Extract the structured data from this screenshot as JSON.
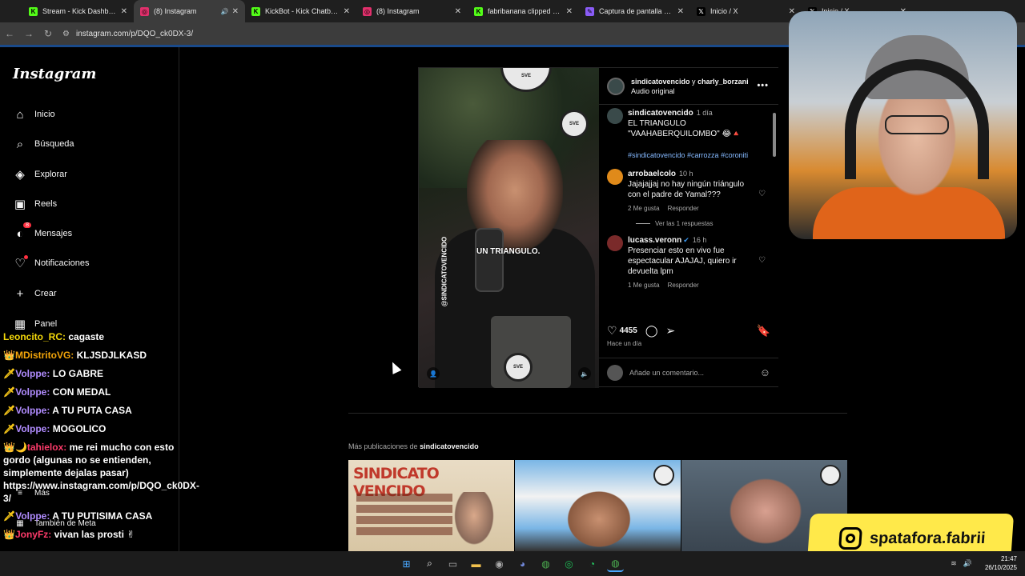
{
  "browser": {
    "tabs": [
      {
        "title": "Stream - Kick Dashboard",
        "icon": "kick-icon",
        "color": "#53fc18"
      },
      {
        "title": "(8) Instagram",
        "icon": "instagram-icon",
        "color": "#e1306c",
        "active": true
      },
      {
        "title": "KickBot - Kick Chatbot, Al",
        "icon": "kick-icon",
        "color": "#53fc18"
      },
      {
        "title": "(8) Instagram",
        "icon": "instagram-icon",
        "color": "#e1306c"
      },
      {
        "title": "fabribanana clipped by Vo",
        "icon": "kick-icon",
        "color": "#53fc18"
      },
      {
        "title": "Captura de pantalla por L",
        "icon": "feather-icon",
        "color": "#8a5cf6"
      },
      {
        "title": "Inicio / X",
        "icon": "x-icon",
        "color": "#ffffff"
      },
      {
        "title": "Inicio / X",
        "icon": "x-icon",
        "color": "#ffffff"
      }
    ],
    "url": "instagram.com/p/DQO_ck0DX-3/"
  },
  "sidebar": {
    "logo": "Instagram",
    "items": [
      {
        "label": "Inicio",
        "icon": "home-icon"
      },
      {
        "label": "Búsqueda",
        "icon": "search-icon"
      },
      {
        "label": "Explorar",
        "icon": "compass-icon"
      },
      {
        "label": "Reels",
        "icon": "reels-icon"
      },
      {
        "label": "Mensajes",
        "icon": "messenger-icon",
        "badge": "8"
      },
      {
        "label": "Notificaciones",
        "icon": "heart-icon"
      },
      {
        "label": "Crear",
        "icon": "plus-icon"
      },
      {
        "label": "Panel",
        "icon": "dashboard-icon"
      }
    ],
    "more": "Más",
    "meta": "También de Meta"
  },
  "chat": [
    {
      "user": "Leoncito_RC:",
      "msg": "cagaste",
      "color": "#f5d90a",
      "prefix": ""
    },
    {
      "user": "MDistritoVG:",
      "msg": "KLJSDJLKASD",
      "color": "#f5a60a",
      "prefix": "👑"
    },
    {
      "user": "Volppe:",
      "msg": "LO GABRE",
      "color": "#b18cff",
      "prefix": "🗡"
    },
    {
      "user": "Volppe:",
      "msg": "CON MEDAL",
      "color": "#b18cff",
      "prefix": "🗡"
    },
    {
      "user": "Volppe:",
      "msg": "A TU PUTA CASA",
      "color": "#b18cff",
      "prefix": "🗡"
    },
    {
      "user": "Volppe:",
      "msg": "MOGOLICO",
      "color": "#b18cff",
      "prefix": "🗡"
    },
    {
      "user": "tahielox:",
      "msg": "me rei mucho con esto gordo (algunas no se entienden, simplemente dejalas pasar) https://www.instagram.com/p/DQO_ck0DX-3/",
      "color": "#ff3b6b",
      "prefix": "👑🌙"
    },
    {
      "user": "Volppe:",
      "msg": "A TU PUTISIMA CASA",
      "color": "#b18cff",
      "prefix": "🗡"
    },
    {
      "user": "JonyFz:",
      "msg": "vivan las prosti ✌",
      "color": "#ff3b6b",
      "prefix": "👑"
    }
  ],
  "post": {
    "author": "sindicatovencido",
    "coauthor": "charly_borzani",
    "joiner": "y",
    "audio": "Audio original",
    "video_caption": "UN TRIANGULO.",
    "video_watermark": "@SINDICATOVENCIDO",
    "stamp_text": "SVE",
    "caption": {
      "user": "sindicatovencido",
      "time": "1 día",
      "text": "EL TRIANGULO \"VAAHABERQUILOMBO\" 😂🔺",
      "tags": "#sindicatovencido #carrozza #coroniti"
    },
    "comments": [
      {
        "user": "arrobaelcolo",
        "time": "10 h",
        "text": "Jajajajjaj no hay ningún triángulo con el padre de Yamal???",
        "likes": "2 Me gusta",
        "reply": "Responder",
        "replies": "Ver las 1 respuestas",
        "avatar_color": "#e08a1a"
      },
      {
        "user": "lucass.veronn",
        "time": "16 h",
        "text": "Presenciar esto en vivo fue espectacular AJAJAJ, quiero ir devuelta lpm",
        "likes": "1 Me gusta",
        "reply": "Responder",
        "verified": true,
        "avatar_color": "#7a2a2a"
      }
    ],
    "likes": "4455",
    "ago": "Hace un día",
    "add_comment_placeholder": "Añade un comentario..."
  },
  "more_posts": {
    "prefix": "Más publicaciones de",
    "user": "sindicatovencido",
    "thumb1_title": "SINDICATO VENCIDO"
  },
  "overlay": {
    "ig_handle": "spatafora.fabrii"
  },
  "taskbar": {
    "time": "21:47",
    "date": "26/10/2025"
  }
}
